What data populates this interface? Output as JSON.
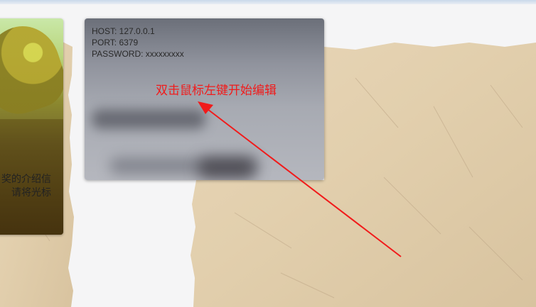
{
  "left_card": {
    "line1": "奖的介绍信",
    "line2": "请将光标"
  },
  "info_card": {
    "host": "HOST: 127.0.0.1",
    "port": "PORT: 6379",
    "password": "PASSWORD: xxxxxxxxx"
  },
  "hint": {
    "text": "双击鼠标左键开始编辑"
  },
  "colors": {
    "hint_red": "#f11b1b",
    "paper_tan": "#e7d5b6"
  }
}
